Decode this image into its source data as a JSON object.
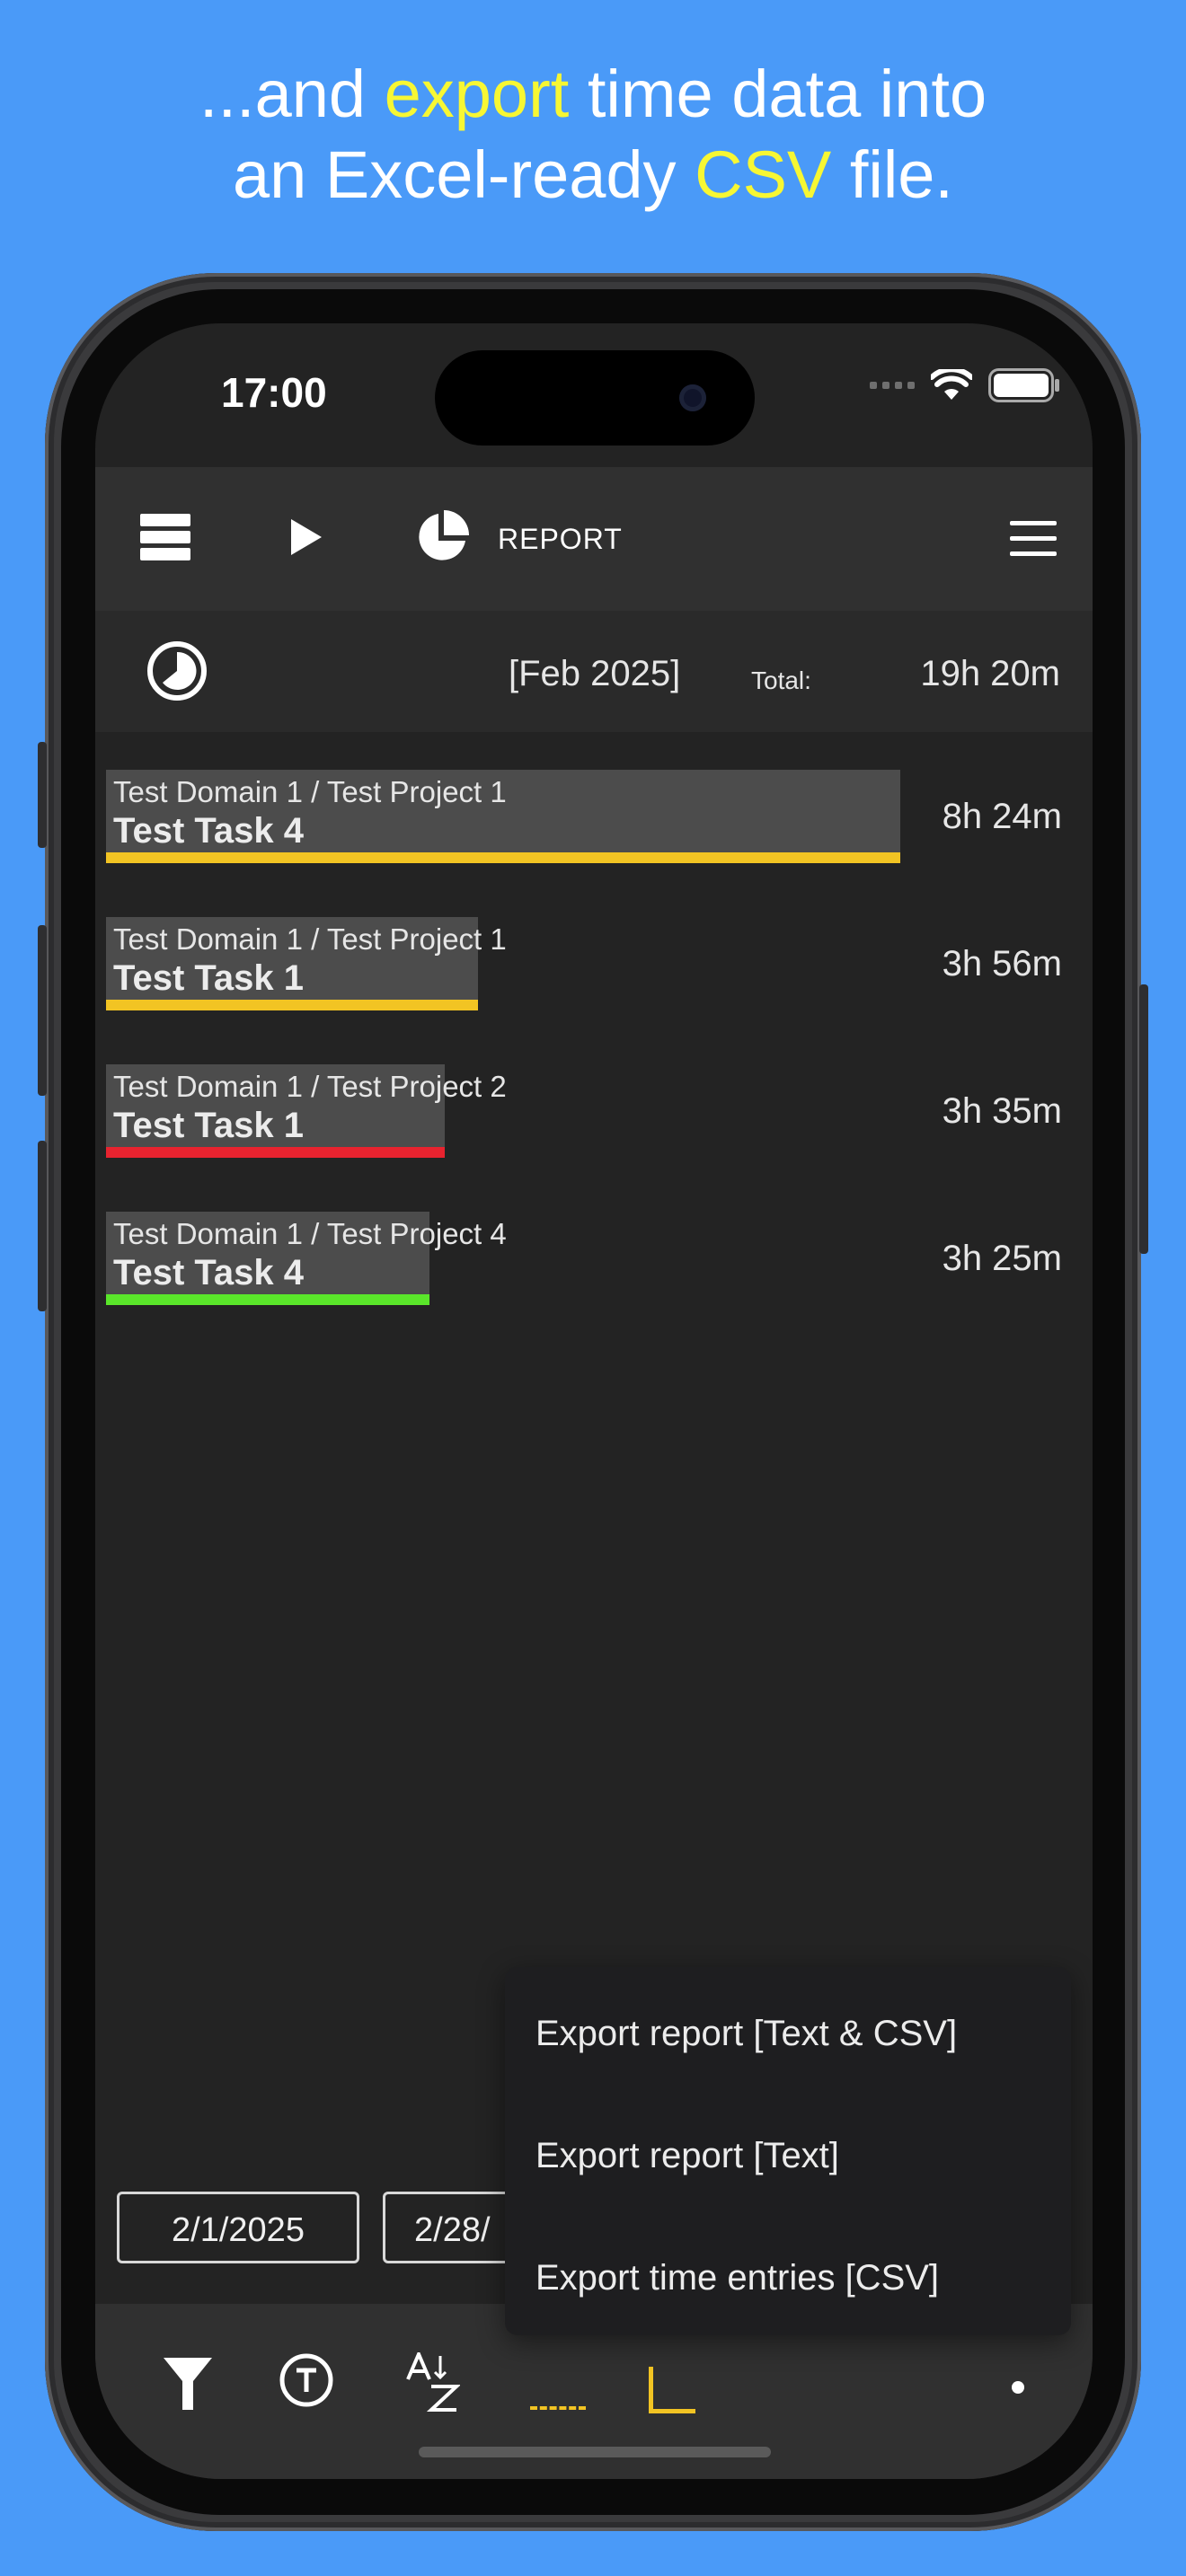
{
  "headline": {
    "line1_prefix": "...and ",
    "line1_highlight": "export",
    "line1_suffix": " time data into",
    "line2_prefix": "an Excel-ready ",
    "line2_highlight": "CSV",
    "line2_suffix": " file."
  },
  "status_bar": {
    "time": "17:00"
  },
  "toolbar": {
    "report_label": "REPORT"
  },
  "summary": {
    "period": "[Feb 2025]",
    "total_label": "Total:",
    "total_value": "19h 20m"
  },
  "report_rows": [
    {
      "path": "Test Domain 1 / Test Project 1",
      "task": "Test Task 4",
      "duration": "8h 24m",
      "share": 1.0,
      "color": "#f2c423"
    },
    {
      "path": "Test Domain 1 / Test Project 1",
      "task": "Test Task 1",
      "duration": "3h 56m",
      "share": 0.468,
      "color": "#f2c423"
    },
    {
      "path": "Test Domain 1 / Test Project 2",
      "task": "Test Task 1",
      "duration": "3h 35m",
      "share": 0.426,
      "color": "#e8232f"
    },
    {
      "path": "Test Domain 1 / Test Project 4",
      "task": "Test Task 4",
      "duration": "3h 25m",
      "share": 0.407,
      "color": "#5ae62a"
    }
  ],
  "date_range": {
    "start": "2/1/2025",
    "end": "2/28/"
  },
  "export_menu": {
    "items": [
      "Export report [Text & CSV]",
      "Export report [Text]",
      "Export time entries [CSV]"
    ]
  },
  "icons": {
    "toolbar": [
      "list-icon",
      "play-icon",
      "pie-chart-icon",
      "hamburger-menu-icon"
    ],
    "summary": "pie-clock-icon",
    "bottom": [
      "filter-icon",
      "text-circle-icon",
      "sort-az-icon"
    ]
  },
  "colors": {
    "background": "#4a9af8",
    "highlight": "#f7f733",
    "accent": "#f2c423"
  }
}
